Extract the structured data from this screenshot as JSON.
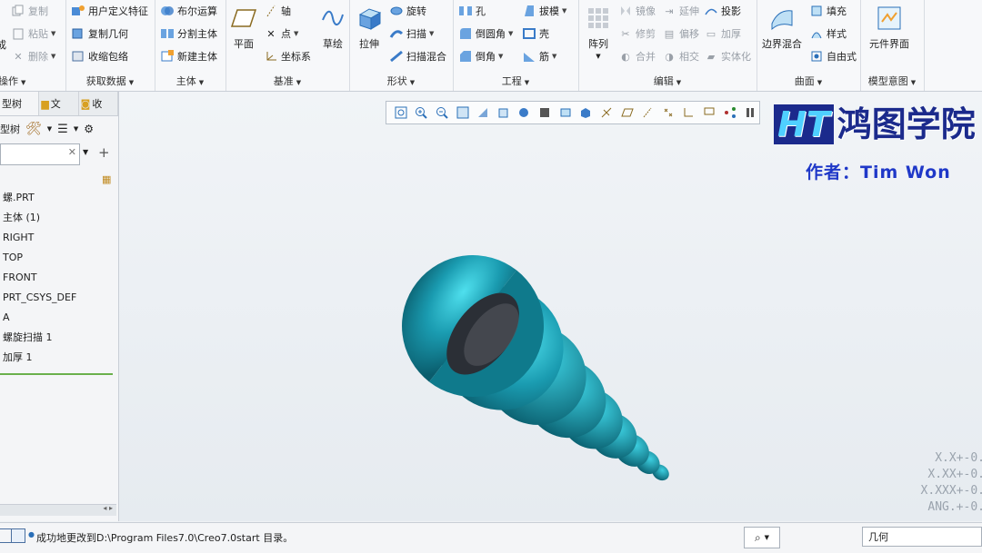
{
  "ribbon": {
    "groups": {
      "operations": {
        "label": "操作",
        "items": {
          "copy": "复制",
          "paste": "粘贴",
          "delete": "删除",
          "regen": "成"
        }
      },
      "get_data": {
        "label": "获取数据",
        "items": {
          "udf": "用户定义特征",
          "copy_geom": "复制几何",
          "shrinkwrap": "收缩包络"
        }
      },
      "body": {
        "label": "主体",
        "items": {
          "boolean": "布尔运算",
          "split": "分割主体",
          "new_body": "新建主体"
        }
      },
      "datum": {
        "label": "基准",
        "items": {
          "plane": "平面",
          "axis": "轴",
          "point": "点",
          "csys": "坐标系",
          "sketch": "草绘"
        }
      },
      "shapes": {
        "label": "形状",
        "items": {
          "extrude": "拉伸",
          "revolve": "旋转",
          "sweep": "扫描",
          "swept_blend": "扫描混合"
        }
      },
      "engineering": {
        "label": "工程",
        "items": {
          "hole": "孔",
          "round": "倒圆角",
          "chamfer": "倒角",
          "draft": "拔模",
          "shell": "壳",
          "rib": "筋"
        }
      },
      "editing": {
        "label": "编辑",
        "items": {
          "pattern": "阵列",
          "mirror": "镜像",
          "extend": "延伸",
          "project": "投影",
          "trim": "修剪",
          "offset": "偏移",
          "thicken": "加厚",
          "merge": "合并",
          "intersect": "相交",
          "solidify": "实体化"
        }
      },
      "surfaces": {
        "label": "曲面",
        "items": {
          "boundary": "边界混合",
          "fill": "填充",
          "style": "样式",
          "freestyle": "自由式"
        }
      },
      "model_intent": {
        "label": "模型意图",
        "items": {
          "component_interface": "元件界面"
        }
      }
    }
  },
  "navigator": {
    "tabs": [
      "型树",
      "文",
      "收"
    ],
    "tool_label": "型树",
    "tree": [
      "螺.PRT",
      "主体 (1)",
      "RIGHT",
      "TOP",
      "FRONT",
      "PRT_CSYS_DEF",
      "A",
      "螺旋扫描 1",
      "加厚 1"
    ]
  },
  "viewport": {
    "watermark_brand": "鸿图学院",
    "watermark_author": "作者：Tim Won",
    "tolerances": [
      "X.X+-0.",
      "X.XX+-0.",
      "X.XXX+-0.",
      "ANG.+-0."
    ]
  },
  "status": {
    "message": "成功地更改到D:\\Program Files7.0\\Creo7.0start 目录。",
    "filter": "几何"
  },
  "colors": {
    "model": "#1a8fa3",
    "accent": "#2a7fd4"
  }
}
